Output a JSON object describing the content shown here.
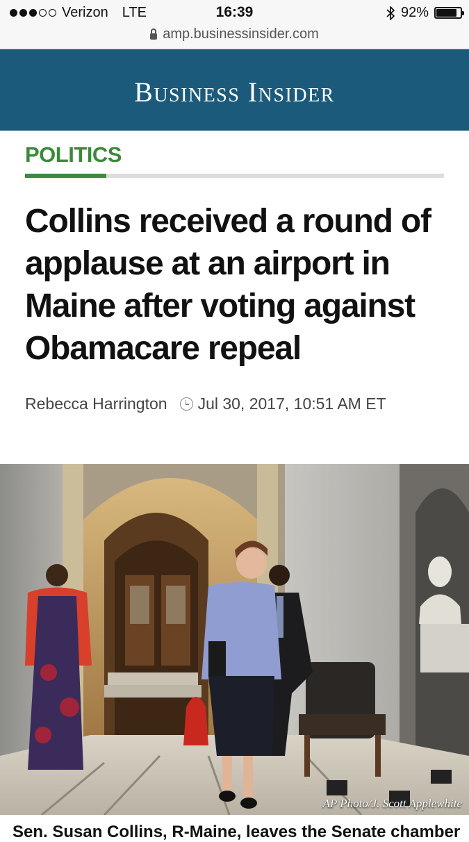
{
  "status_bar": {
    "carrier": "Verizon",
    "network": "LTE",
    "time": "16:39",
    "battery": "92%",
    "battery_level": 0.92,
    "signal_bars_filled": 3,
    "signal_bars_total": 5,
    "icons": [
      "bluetooth-icon",
      "battery-icon"
    ]
  },
  "url_bar": {
    "url": "amp.businessinsider.com",
    "icon": "lock-icon"
  },
  "header": {
    "logo_text": "Business Insider",
    "background": "#1b5a7a"
  },
  "article": {
    "section": "POLITICS",
    "section_color": "#3a8a3a",
    "headline": "Collins received a round of applause at an airport in Maine after voting against Obamacare repeal",
    "author": "Rebecca Harrington",
    "timestamp": "Jul 30, 2017, 10:51 AM ET",
    "photo_credit": "AP Photo/J. Scott Applewhite",
    "caption": "Sen. Susan Collins, R-Maine, leaves the Senate chamber"
  }
}
